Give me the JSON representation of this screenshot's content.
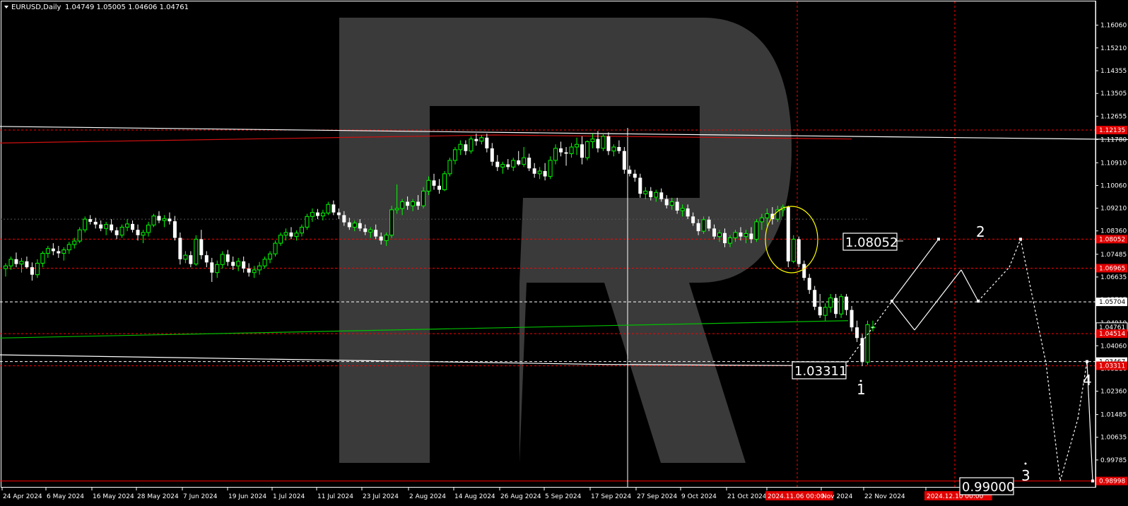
{
  "header": {
    "symbol": "EURUSD,Daily",
    "ohlc": "1.04749 1.05005 1.04606 1.04761"
  },
  "colors": {
    "background": "#000000",
    "bull": "#00ff00",
    "bear": "#ffffff",
    "dotted_level": "#ff0000",
    "tag_red": "#e00000",
    "ma_green": "#00c000",
    "ma_red": "#d01010",
    "ellipse": "#ffff00",
    "watermark": "#3a3a3a"
  },
  "icons": {
    "menu": "triangle-down-icon"
  },
  "chart_data": {
    "type": "candlestick",
    "title": "EURUSD,Daily",
    "y_range": [
      0.9875,
      1.1695
    ],
    "price_ticks": [
      "1.16060",
      "1.15210",
      "1.14355",
      "1.13505",
      "1.12655",
      "1.11780",
      "1.10910",
      "1.10060",
      "1.09210",
      "1.08360",
      "1.07485",
      "1.06635",
      "1.05785",
      "1.04910",
      "1.04060",
      "1.03210",
      "1.02360",
      "1.01485",
      "1.00635",
      "0.99785"
    ],
    "date_ticks": [
      "24 Apr 2024",
      "6 May 2024",
      "16 May 2024",
      "28 May 2024",
      "7 Jun 2024",
      "19 Jun 2024",
      "1 Jul 2024",
      "11 Jul 2024",
      "23 Jul 2024",
      "2 Aug 2024",
      "14 Aug 2024",
      "26 Aug 2024",
      "5 Sep 2024",
      "17 Sep 2024",
      "27 Sep 2024",
      "9 Oct 2024",
      "21 Oct 2024",
      "2024.11.06 00:00",
      "Nov 2024",
      "22 Nov 2024",
      "2024.12.10 00:00"
    ],
    "ohlc_last": [
      1.04749,
      1.05005,
      1.04606,
      1.04761
    ],
    "price_levels": [
      {
        "price": 1.12135,
        "label": "1.12135",
        "style": "red-dotted"
      },
      {
        "price": 1.08052,
        "label": "1.08052",
        "style": "red-dotted"
      },
      {
        "price": 1.06965,
        "label": "1.06965",
        "style": "red-dotted"
      },
      {
        "price": 1.05704,
        "label": "1.05704",
        "style": "white-dashed"
      },
      {
        "price": 1.04761,
        "label": "1.04761",
        "style": "current"
      },
      {
        "price": 1.04514,
        "label": "1.04514",
        "style": "red-dotted"
      },
      {
        "price": 1.03467,
        "label": "1.03467",
        "style": "white-dashed"
      },
      {
        "price": 1.03311,
        "label": "1.03311",
        "style": "red-dotted"
      },
      {
        "price": 0.98998,
        "label": "0.98998",
        "style": "red-solid"
      }
    ],
    "annotations": [
      {
        "text": "1.08052",
        "kind": "price-box"
      },
      {
        "text": "1.03311",
        "kind": "price-box"
      },
      {
        "text": "0.99000",
        "kind": "price-box"
      },
      {
        "text": "1",
        "kind": "wave"
      },
      {
        "text": "2",
        "kind": "wave"
      },
      {
        "text": "3",
        "kind": "wave"
      },
      {
        "text": "4",
        "kind": "wave"
      }
    ],
    "candles": [
      [
        1.0695,
        1.0715,
        1.0665,
        1.0705
      ],
      [
        1.0705,
        1.074,
        1.069,
        1.073
      ],
      [
        1.073,
        1.0755,
        1.07,
        1.0712
      ],
      [
        1.0712,
        1.0735,
        1.068,
        1.0722
      ],
      [
        1.0722,
        1.074,
        1.0695,
        1.07
      ],
      [
        1.07,
        1.0718,
        1.065,
        1.0672
      ],
      [
        1.0672,
        1.073,
        1.066,
        1.0715
      ],
      [
        1.0715,
        1.076,
        1.07,
        1.0752
      ],
      [
        1.0752,
        1.078,
        1.0735,
        1.077
      ],
      [
        1.077,
        1.079,
        1.0745,
        1.076
      ],
      [
        1.076,
        1.078,
        1.0735,
        1.0752
      ],
      [
        1.0752,
        1.0775,
        1.0725,
        1.0765
      ],
      [
        1.0765,
        1.0795,
        1.075,
        1.0785
      ],
      [
        1.0785,
        1.081,
        1.077,
        1.0798
      ],
      [
        1.0798,
        1.085,
        1.079,
        1.084
      ],
      [
        1.084,
        1.089,
        1.083,
        1.088
      ],
      [
        1.088,
        1.0895,
        1.086,
        1.087
      ],
      [
        1.087,
        1.0885,
        1.0845,
        1.086
      ],
      [
        1.086,
        1.0875,
        1.0835,
        1.0845
      ],
      [
        1.0845,
        1.087,
        1.082,
        1.086
      ],
      [
        1.086,
        1.088,
        1.083,
        1.0838
      ],
      [
        1.0838,
        1.085,
        1.0805,
        1.082
      ],
      [
        1.082,
        1.086,
        1.081,
        1.085
      ],
      [
        1.085,
        1.088,
        1.0835,
        1.0862
      ],
      [
        1.0862,
        1.0875,
        1.083,
        1.084
      ],
      [
        1.084,
        1.086,
        1.08,
        1.082
      ],
      [
        1.082,
        1.084,
        1.079,
        1.083
      ],
      [
        1.083,
        1.087,
        1.0815,
        1.0858
      ],
      [
        1.0858,
        1.09,
        1.085,
        1.0892
      ],
      [
        1.0892,
        1.091,
        1.0865,
        1.0875
      ],
      [
        1.0875,
        1.0895,
        1.085,
        1.0882
      ],
      [
        1.0882,
        1.0905,
        1.086,
        1.0872
      ],
      [
        1.0872,
        1.0892,
        1.08,
        1.081
      ],
      [
        1.081,
        1.083,
        1.071,
        1.073
      ],
      [
        1.073,
        1.076,
        1.0715,
        1.0745
      ],
      [
        1.0745,
        1.076,
        1.07,
        1.0712
      ],
      [
        1.0712,
        1.082,
        1.0705,
        1.0805
      ],
      [
        1.0805,
        1.084,
        1.073,
        1.0745
      ],
      [
        1.0745,
        1.076,
        1.07,
        1.0718
      ],
      [
        1.0718,
        1.0735,
        1.0645,
        1.068
      ],
      [
        1.068,
        1.0725,
        1.066,
        1.071
      ],
      [
        1.071,
        1.076,
        1.0695,
        1.0748
      ],
      [
        1.0748,
        1.0765,
        1.0705,
        1.072
      ],
      [
        1.072,
        1.074,
        1.069,
        1.0705
      ],
      [
        1.0705,
        1.0735,
        1.0685,
        1.0722
      ],
      [
        1.0722,
        1.074,
        1.068,
        1.0695
      ],
      [
        1.0695,
        1.0715,
        1.0665,
        1.068
      ],
      [
        1.068,
        1.0705,
        1.066,
        1.069
      ],
      [
        1.069,
        1.072,
        1.0672,
        1.0705
      ],
      [
        1.0705,
        1.074,
        1.0695,
        1.073
      ],
      [
        1.073,
        1.076,
        1.0715,
        1.075
      ],
      [
        1.075,
        1.08,
        1.074,
        1.079
      ],
      [
        1.079,
        1.083,
        1.078,
        1.082
      ],
      [
        1.082,
        1.0845,
        1.08,
        1.083
      ],
      [
        1.083,
        1.085,
        1.0805,
        1.0815
      ],
      [
        1.0815,
        1.0838,
        1.08,
        1.0828
      ],
      [
        1.0828,
        1.086,
        1.0815,
        1.085
      ],
      [
        1.085,
        1.09,
        1.084,
        1.089
      ],
      [
        1.089,
        1.092,
        1.087,
        1.0905
      ],
      [
        1.0905,
        1.0918,
        1.088,
        1.0892
      ],
      [
        1.0892,
        1.0915,
        1.0875,
        1.0903
      ],
      [
        1.0903,
        1.0945,
        1.0895,
        1.0935
      ],
      [
        1.0935,
        1.095,
        1.0895,
        1.0905
      ],
      [
        1.0905,
        1.092,
        1.088,
        1.0895
      ],
      [
        1.0895,
        1.091,
        1.0855,
        1.0868
      ],
      [
        1.0868,
        1.0885,
        1.084,
        1.085
      ],
      [
        1.085,
        1.0875,
        1.0835,
        1.0865
      ],
      [
        1.0865,
        1.088,
        1.0835,
        1.0845
      ],
      [
        1.0845,
        1.086,
        1.082,
        1.0832
      ],
      [
        1.0832,
        1.085,
        1.081,
        1.084
      ],
      [
        1.084,
        1.086,
        1.0805,
        1.0815
      ],
      [
        1.0815,
        1.083,
        1.0785,
        1.08
      ],
      [
        1.08,
        1.083,
        1.078,
        1.082
      ],
      [
        1.082,
        1.093,
        1.081,
        1.0915
      ],
      [
        1.0915,
        1.101,
        1.09,
        1.092
      ],
      [
        1.092,
        1.0955,
        1.0895,
        1.0945
      ],
      [
        1.0945,
        1.0965,
        1.0915,
        1.093
      ],
      [
        1.093,
        1.0955,
        1.091,
        1.0945
      ],
      [
        1.0945,
        1.097,
        1.0915,
        1.093
      ],
      [
        1.093,
        1.1,
        1.092,
        1.0985
      ],
      [
        1.0985,
        1.104,
        1.097,
        1.1025
      ],
      [
        1.1025,
        1.105,
        1.099,
        1.1005
      ],
      [
        1.1005,
        1.103,
        1.0975,
        1.099
      ],
      [
        1.099,
        1.106,
        1.0985,
        1.105
      ],
      [
        1.105,
        1.111,
        1.104,
        1.11
      ],
      [
        1.11,
        1.115,
        1.1085,
        1.114
      ],
      [
        1.114,
        1.1175,
        1.112,
        1.116
      ],
      [
        1.116,
        1.1175,
        1.112,
        1.1135
      ],
      [
        1.1135,
        1.119,
        1.1125,
        1.118
      ],
      [
        1.118,
        1.12,
        1.1155,
        1.1172
      ],
      [
        1.1172,
        1.1195,
        1.116,
        1.1185
      ],
      [
        1.1185,
        1.12,
        1.113,
        1.1145
      ],
      [
        1.1145,
        1.1165,
        1.108,
        1.1095
      ],
      [
        1.1095,
        1.112,
        1.106,
        1.1075
      ],
      [
        1.1075,
        1.1095,
        1.105,
        1.1085
      ],
      [
        1.1085,
        1.1105,
        1.1065,
        1.1075
      ],
      [
        1.1075,
        1.111,
        1.106,
        1.11
      ],
      [
        1.11,
        1.1135,
        1.108,
        1.1085
      ],
      [
        1.1085,
        1.115,
        1.1075,
        1.111
      ],
      [
        1.111,
        1.1125,
        1.106,
        1.107
      ],
      [
        1.107,
        1.109,
        1.1035,
        1.105
      ],
      [
        1.105,
        1.1075,
        1.103,
        1.106
      ],
      [
        1.106,
        1.109,
        1.1025,
        1.104
      ],
      [
        1.104,
        1.1115,
        1.103,
        1.11
      ],
      [
        1.11,
        1.116,
        1.1085,
        1.1145
      ],
      [
        1.1145,
        1.117,
        1.1115,
        1.113
      ],
      [
        1.113,
        1.115,
        1.108,
        1.1125
      ],
      [
        1.1125,
        1.1165,
        1.111,
        1.115
      ],
      [
        1.115,
        1.1185,
        1.112,
        1.116
      ],
      [
        1.116,
        1.119,
        1.1085,
        1.111
      ],
      [
        1.111,
        1.1175,
        1.11,
        1.117
      ],
      [
        1.117,
        1.12,
        1.1145,
        1.118
      ],
      [
        1.118,
        1.121,
        1.113,
        1.1145
      ],
      [
        1.1145,
        1.12,
        1.1135,
        1.119
      ],
      [
        1.119,
        1.1205,
        1.112,
        1.1135
      ],
      [
        1.1135,
        1.116,
        1.1115,
        1.115
      ],
      [
        1.115,
        1.1175,
        1.1125,
        1.1135
      ],
      [
        1.1135,
        1.115,
        1.105,
        1.1065
      ],
      [
        1.1065,
        1.108,
        1.104,
        1.105
      ],
      [
        1.105,
        1.1065,
        1.102,
        1.1035
      ],
      [
        1.1035,
        1.105,
        1.096,
        1.0975
      ],
      [
        1.0975,
        1.1,
        1.0955,
        1.0985
      ],
      [
        1.0985,
        1.1,
        1.095,
        1.0962
      ],
      [
        1.0962,
        1.099,
        1.0945,
        1.098
      ],
      [
        1.098,
        1.0995,
        1.0945,
        1.0955
      ],
      [
        1.0955,
        1.097,
        1.092,
        1.0932
      ],
      [
        1.0932,
        1.096,
        1.0915,
        1.0945
      ],
      [
        1.0945,
        1.096,
        1.09,
        1.0912
      ],
      [
        1.0912,
        1.0935,
        1.089,
        1.092
      ],
      [
        1.092,
        1.0935,
        1.088,
        1.089
      ],
      [
        1.089,
        1.0905,
        1.0855,
        1.0865
      ],
      [
        1.0865,
        1.088,
        1.082,
        1.0835
      ],
      [
        1.0835,
        1.089,
        1.0825,
        1.0878
      ],
      [
        1.0878,
        1.089,
        1.0835,
        1.0845
      ],
      [
        1.0845,
        1.086,
        1.0805,
        1.0815
      ],
      [
        1.0815,
        1.084,
        1.0795,
        1.0828
      ],
      [
        1.0828,
        1.0845,
        1.0775,
        1.079
      ],
      [
        1.079,
        1.082,
        1.0775,
        1.081
      ],
      [
        1.081,
        1.084,
        1.0795,
        1.083
      ],
      [
        1.083,
        1.085,
        1.08,
        1.0815
      ],
      [
        1.0815,
        1.084,
        1.079,
        1.0826
      ],
      [
        1.0826,
        1.085,
        1.079,
        1.0805
      ],
      [
        1.0805,
        1.088,
        1.0795,
        1.087
      ],
      [
        1.087,
        1.09,
        1.084,
        1.0885
      ],
      [
        1.0885,
        1.092,
        1.0855,
        1.09
      ],
      [
        1.09,
        1.0925,
        1.086,
        1.088
      ],
      [
        1.088,
        1.093,
        1.087,
        1.0915
      ],
      [
        1.0915,
        1.0935,
        1.089,
        1.0925
      ],
      [
        1.0925,
        1.093,
        1.07,
        1.0722
      ],
      [
        1.0722,
        1.082,
        1.0715,
        1.0805
      ],
      [
        1.0805,
        1.0815,
        1.07,
        1.0712
      ],
      [
        1.0712,
        1.0725,
        1.065,
        1.066
      ],
      [
        1.066,
        1.0675,
        1.06,
        1.0615
      ],
      [
        1.0615,
        1.063,
        1.054,
        1.0552
      ],
      [
        1.0552,
        1.06,
        1.051,
        1.052
      ],
      [
        1.052,
        1.0565,
        1.05,
        1.055
      ],
      [
        1.055,
        1.06,
        1.053,
        1.0585
      ],
      [
        1.0585,
        1.06,
        1.051,
        1.0525
      ],
      [
        1.0525,
        1.06,
        1.051,
        1.059
      ],
      [
        1.059,
        1.06,
        1.052,
        1.054
      ],
      [
        1.054,
        1.0555,
        1.046,
        1.0475
      ],
      [
        1.0475,
        1.05,
        1.042,
        1.0435
      ],
      [
        1.0435,
        1.045,
        1.033,
        1.0345
      ],
      [
        1.0345,
        1.05,
        1.0335,
        1.0485
      ],
      [
        1.0475,
        1.05,
        1.046,
        1.0476
      ]
    ],
    "moving_averages": [
      {
        "color": "white",
        "points": [
          [
            0,
            1.1227
          ],
          [
            860,
            1.12
          ],
          [
            1596,
            1.1178
          ]
        ]
      },
      {
        "color": "red",
        "points": [
          [
            0,
            1.1165
          ],
          [
            700,
            1.1195
          ],
          [
            1205,
            1.118
          ]
        ]
      },
      {
        "color": "green",
        "points": [
          [
            0,
            1.0435
          ],
          [
            1200,
            1.05
          ]
        ]
      },
      {
        "color": "white",
        "points": [
          [
            0,
            1.0372
          ],
          [
            860,
            1.0336
          ],
          [
            1200,
            1.0331
          ]
        ]
      }
    ],
    "forecast_path": [
      {
        "from": [
          1195,
          1.0331
        ],
        "to": [
          1262,
          1.0573
        ],
        "style": "dotted"
      },
      {
        "from": [
          1262,
          1.0573
        ],
        "to": [
          1328,
          1.0805
        ],
        "style": "solid"
      },
      {
        "from": [
          1262,
          1.0573
        ],
        "to": [
          1294,
          1.0465
        ],
        "style": "solid"
      },
      {
        "from": [
          1294,
          1.0465
        ],
        "to": [
          1360,
          1.069
        ],
        "style": "solid"
      },
      {
        "from": [
          1360,
          1.069
        ],
        "to": [
          1384,
          1.0573
        ],
        "style": "solid"
      },
      {
        "from": [
          1384,
          1.0573
        ],
        "to": [
          1428,
          1.07
        ],
        "style": "dotted"
      },
      {
        "from": [
          1428,
          1.07
        ],
        "to": [
          1444,
          1.0805
        ],
        "style": "dotted"
      },
      {
        "from": [
          1444,
          1.0805
        ],
        "to": [
          1480,
          1.034
        ],
        "style": "dotted"
      },
      {
        "from": [
          1480,
          1.034
        ],
        "to": [
          1500,
          0.99
        ],
        "style": "dotted"
      },
      {
        "from": [
          1500,
          0.99
        ],
        "to": [
          1525,
          1.0132
        ],
        "style": "dotted"
      },
      {
        "from": [
          1525,
          1.0132
        ],
        "to": [
          1538,
          1.0347
        ],
        "style": "dotted"
      },
      {
        "from": [
          1538,
          1.0347
        ],
        "to": [
          1546,
          0.99
        ],
        "style": "solid"
      }
    ]
  }
}
